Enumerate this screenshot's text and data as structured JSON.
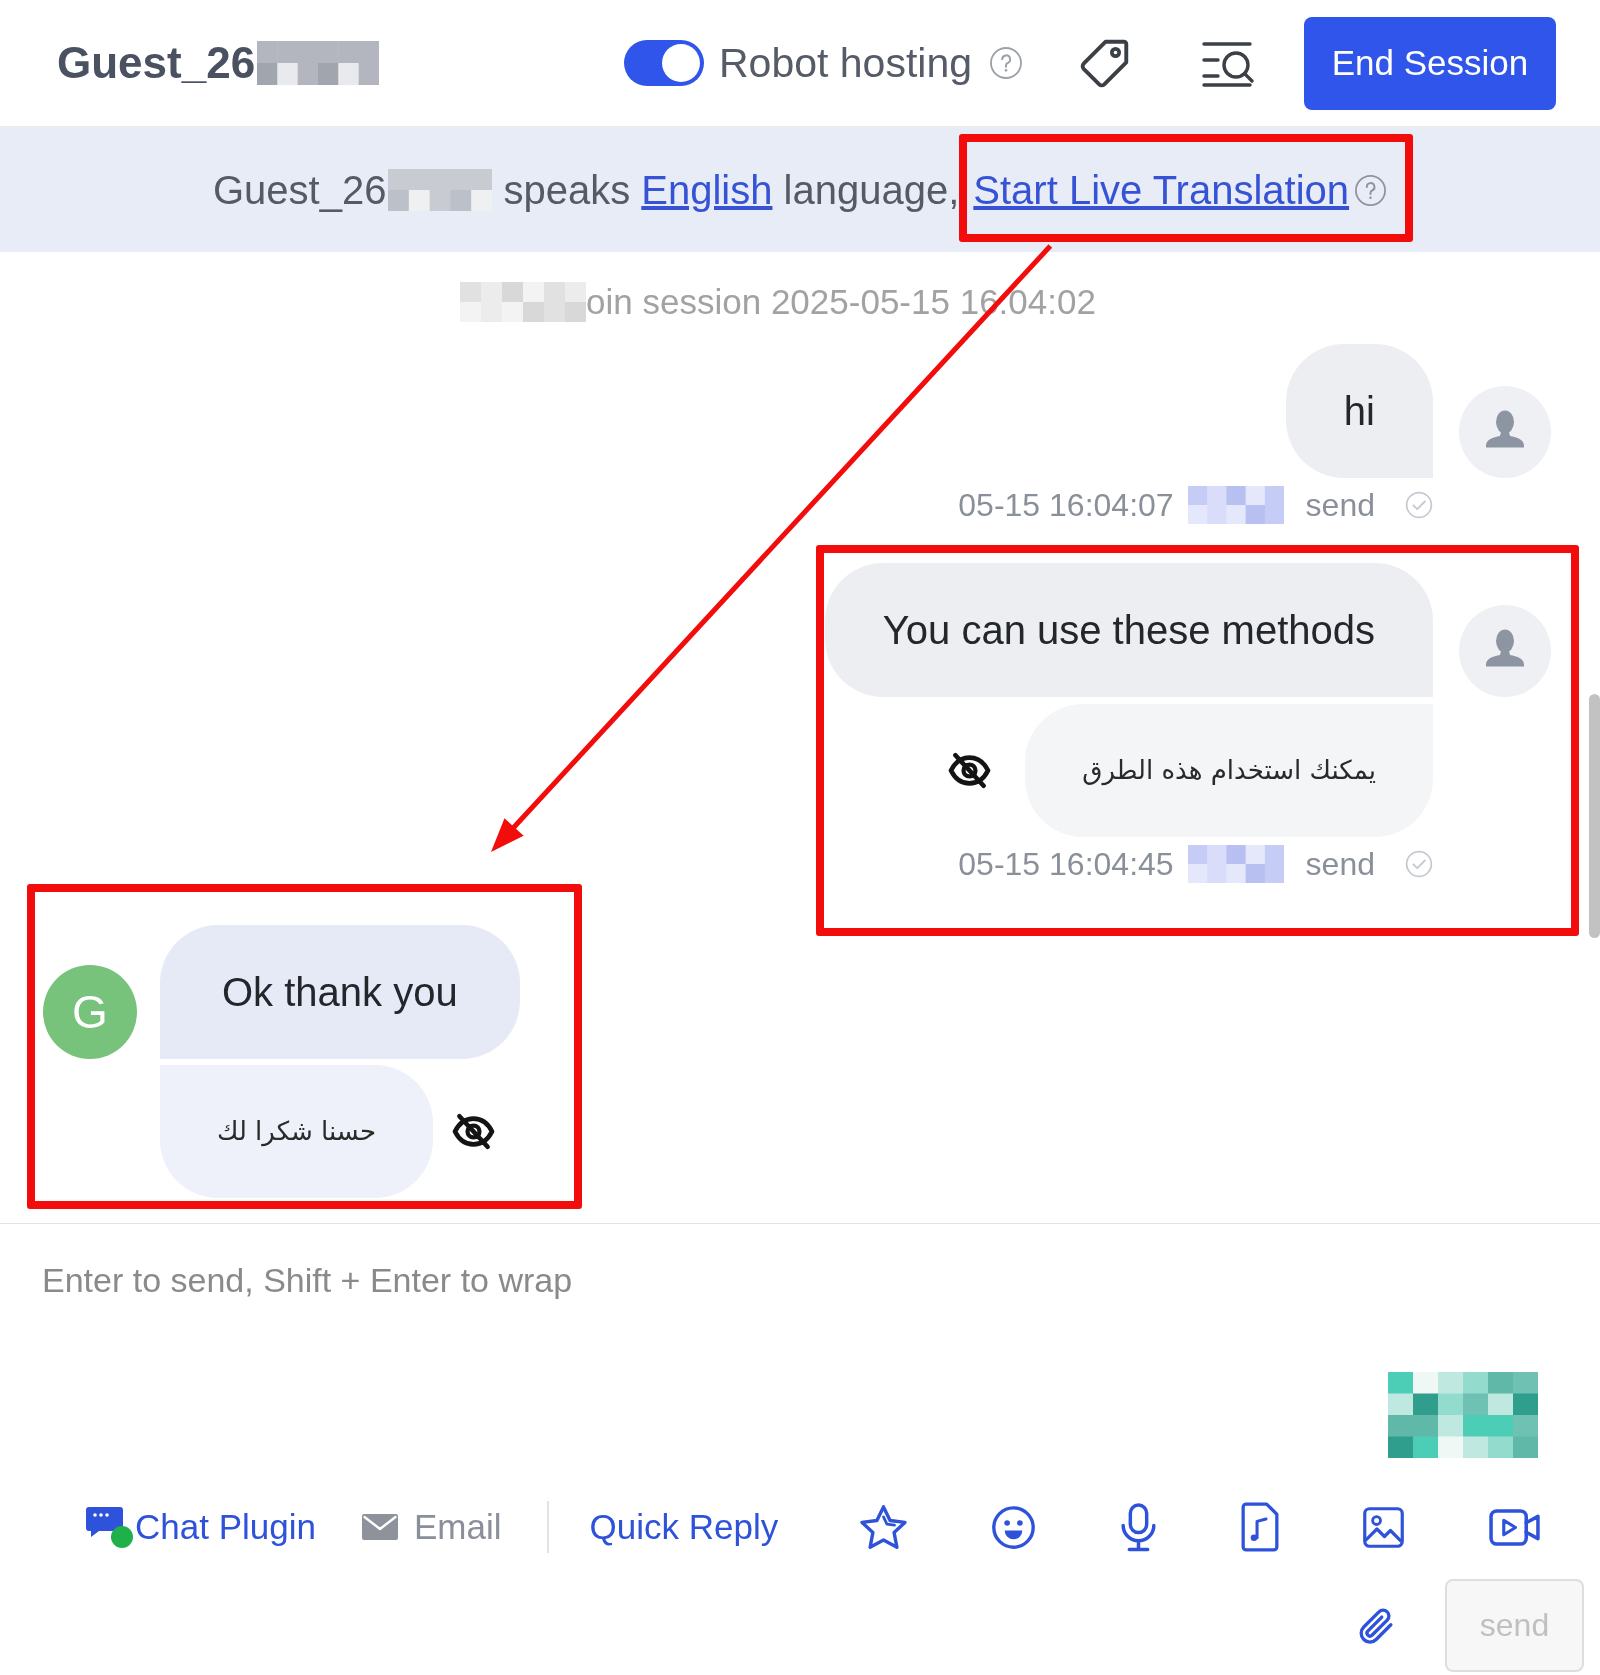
{
  "header": {
    "title": "Guest_26",
    "title_redacted": true,
    "robot_hosting": {
      "label": "Robot hosting",
      "on": true
    },
    "end_session": "End Session"
  },
  "language_banner": {
    "guest_name": "Guest_26",
    "guest_name_redacted": true,
    "text_before": "speaks",
    "language": "English",
    "text_after": "language,",
    "action": {
      "label": "Start Live Translation",
      "highlighted": true
    }
  },
  "messages": [
    {
      "kind": "system",
      "text": "oin session 2025-05-15 16:04:02",
      "prefix_redacted": true
    },
    {
      "kind": "agent",
      "text": "hi",
      "time": "05-15 16:04:07",
      "sender_redacted": true,
      "status": "send"
    },
    {
      "kind": "agent",
      "text": "You can use these methods",
      "translation": "يمكنك استخدام هذه الطرق",
      "time": "05-15 16:04:45",
      "sender_redacted": true,
      "status": "send",
      "highlighted": true
    },
    {
      "kind": "guest",
      "avatar": "G",
      "text": "Ok thank you",
      "translation": "حسنا شكرا لك",
      "highlighted": true
    }
  ],
  "annotation_arrow": true,
  "composer": {
    "placeholder": "Enter to send, Shift + Enter to wrap",
    "pixelated_image": true,
    "tools": [
      {
        "kind": "chat_plugin",
        "label": "Chat Plugin",
        "disabled": false
      },
      {
        "kind": "email",
        "label": "Email",
        "disabled": true
      },
      {
        "kind": "quick_reply",
        "label": "Quick Reply",
        "disabled": false
      }
    ],
    "send_button": {
      "label": "send",
      "disabled": true
    }
  }
}
